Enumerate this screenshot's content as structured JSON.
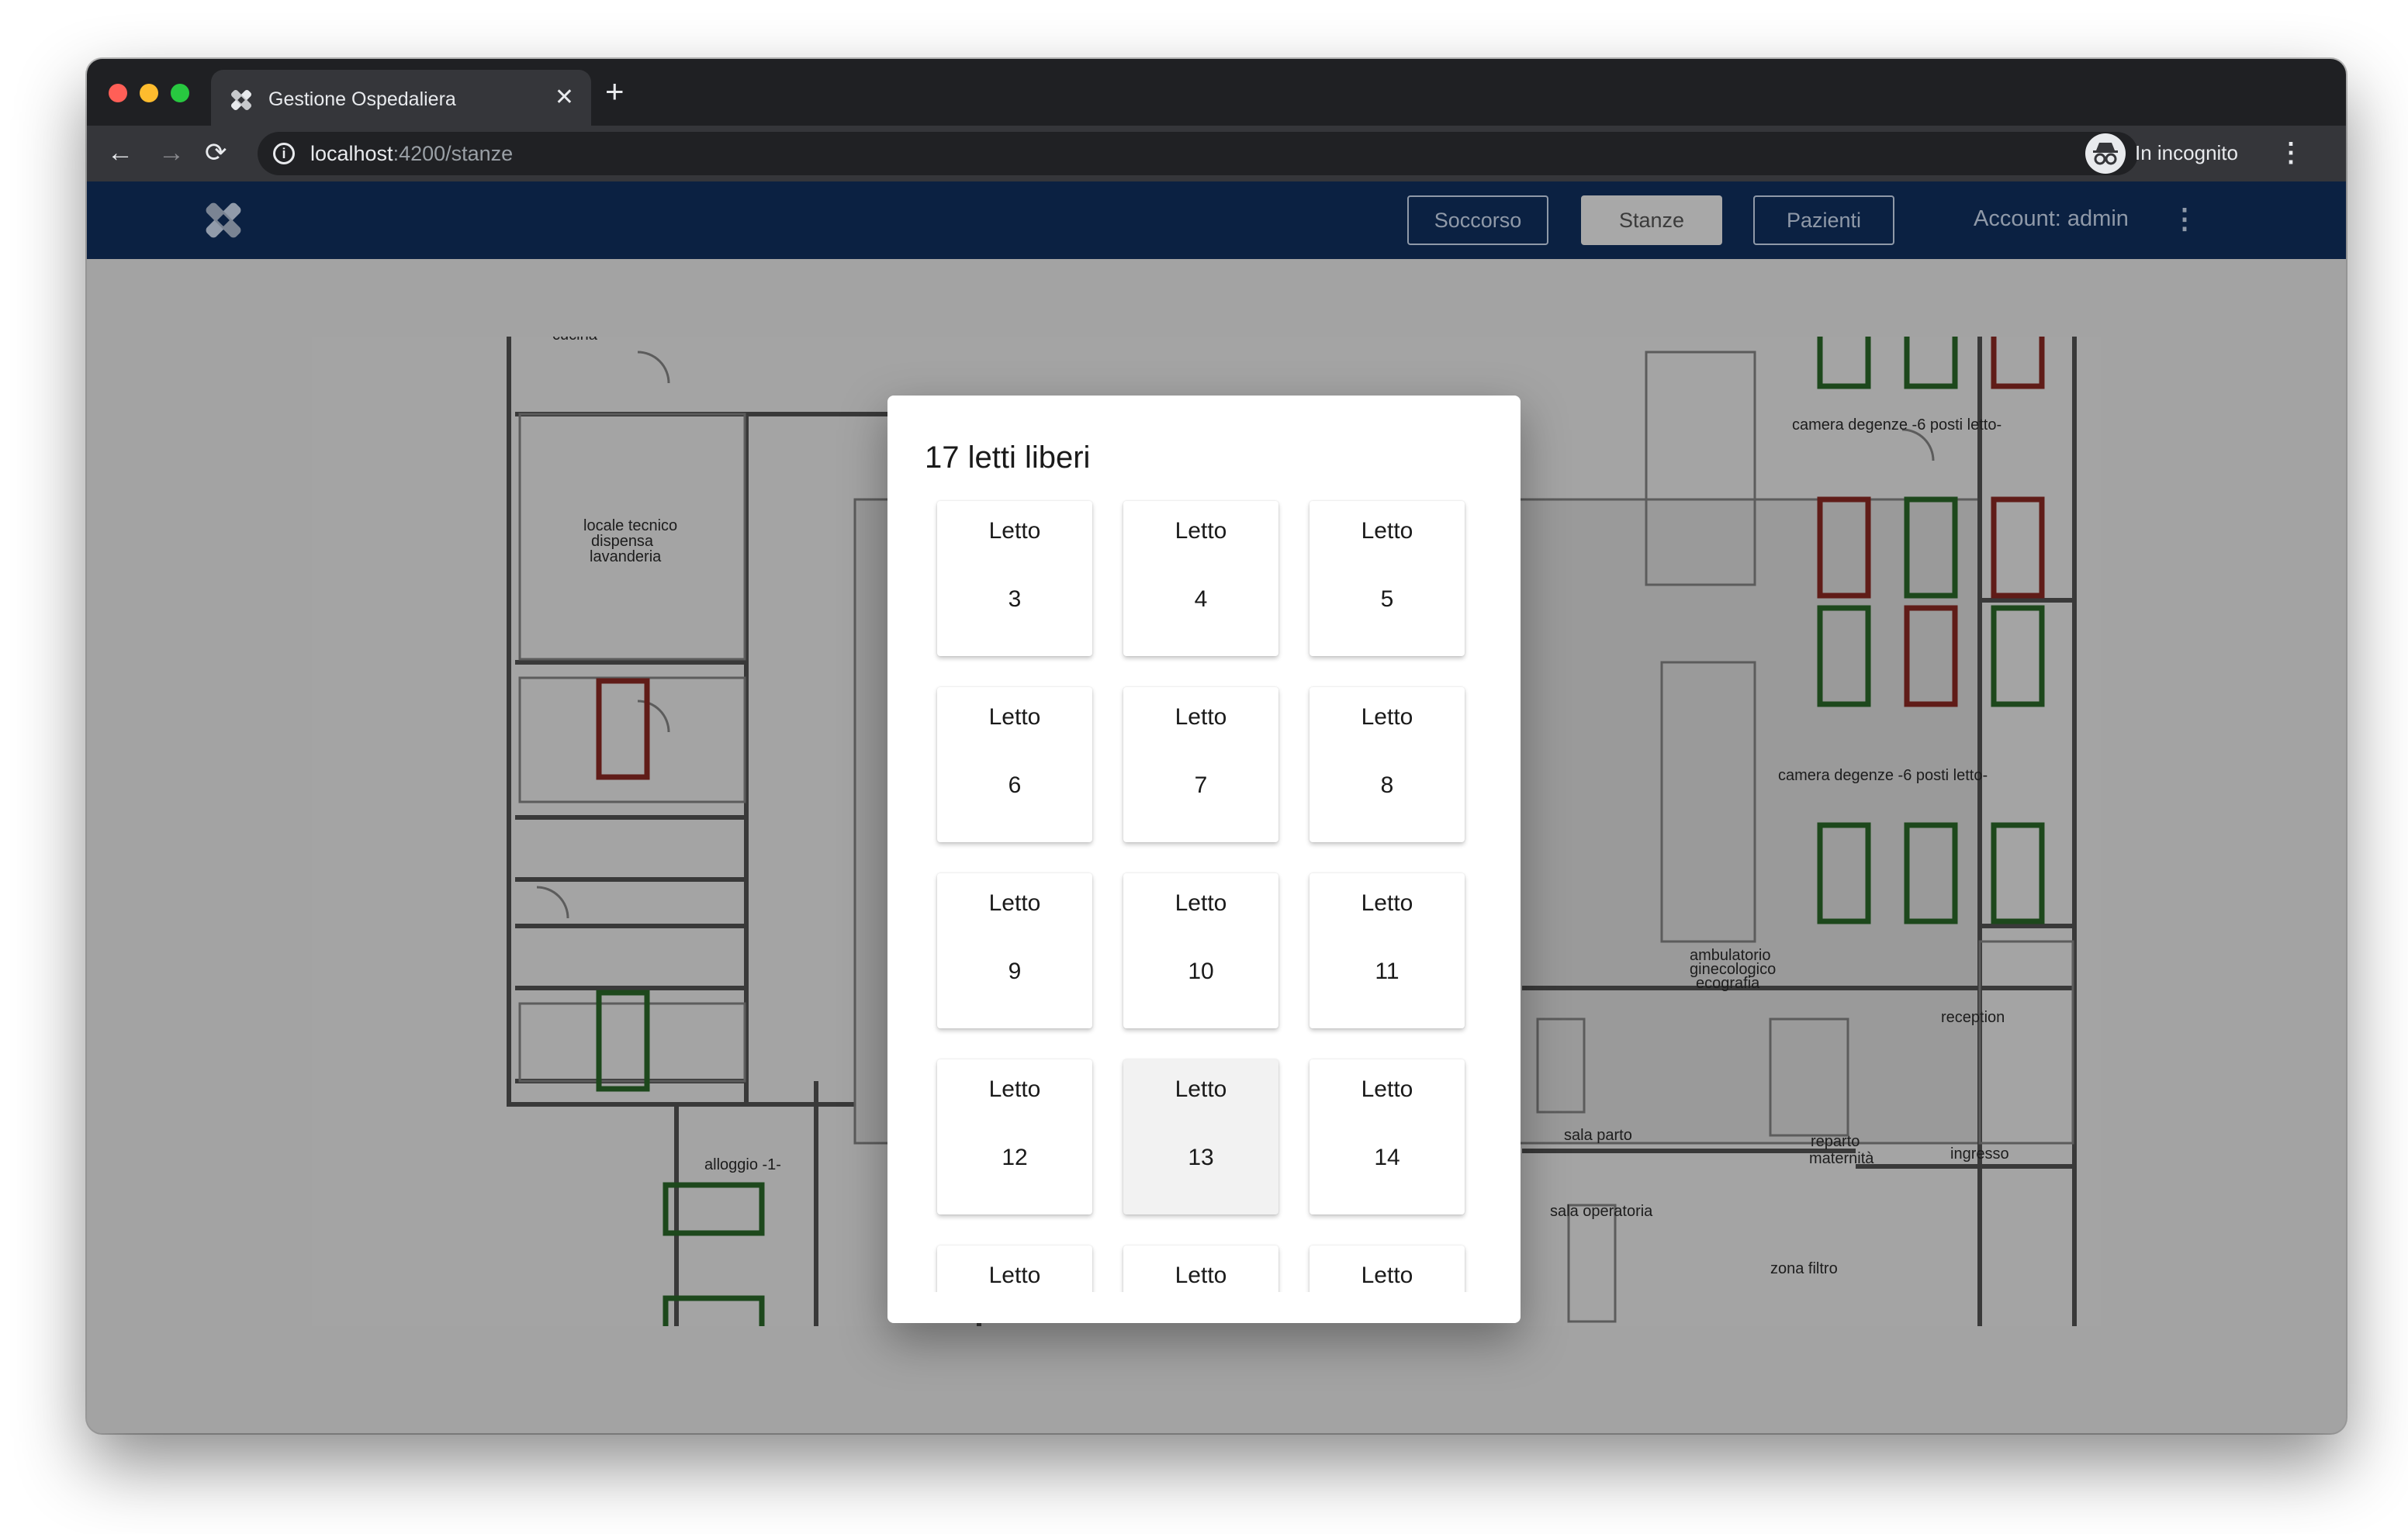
{
  "browser": {
    "tab_title": "Gestione Ospedaliera",
    "tab_close": "✕",
    "new_tab": "+",
    "url_host": "localhost",
    "url_path": ":4200/stanze",
    "incognito_label": "In incognito",
    "icons": {
      "back": "←",
      "forward": "→",
      "reload": "⟳",
      "star": "☆",
      "menu": "⋮",
      "info": "i"
    }
  },
  "header": {
    "nav": [
      {
        "label": "Soccorso"
      },
      {
        "label": "Stanze",
        "active": true
      },
      {
        "label": "Pazienti"
      }
    ],
    "account": "Account: admin",
    "menu_icon": "⋮"
  },
  "floorplan": {
    "labels": {
      "cucina": "cucina",
      "locale_tecnico": [
        "locale tecnico",
        "dispensa",
        "lavanderia"
      ],
      "alloggio": "alloggio -1-",
      "camera_top": "camera degenze -6 posti letto-",
      "camera_mid": "camera degenze -6 posti letto-",
      "ambulatorio": [
        "ambulatorio",
        "ginecologico",
        "ecografia"
      ],
      "reception": "reception",
      "sala_parto": "sala parto",
      "reparto": [
        "reparto",
        "maternità"
      ],
      "ingresso": "ingresso",
      "sala_operatoria": "sala operatoria",
      "zona_filtro": "zona filtro"
    },
    "colors": {
      "occupied": "#8e2a24",
      "free": "#2c6a2a"
    }
  },
  "dialog": {
    "title": "17 letti liberi",
    "bed_word": "Letto",
    "beds": [
      {
        "number": "3"
      },
      {
        "number": "4"
      },
      {
        "number": "5"
      },
      {
        "number": "6"
      },
      {
        "number": "7"
      },
      {
        "number": "8"
      },
      {
        "number": "9"
      },
      {
        "number": "10"
      },
      {
        "number": "11"
      },
      {
        "number": "12"
      },
      {
        "number": "13"
      },
      {
        "number": "14"
      },
      {
        "number": ""
      },
      {
        "number": ""
      },
      {
        "number": ""
      }
    ]
  }
}
